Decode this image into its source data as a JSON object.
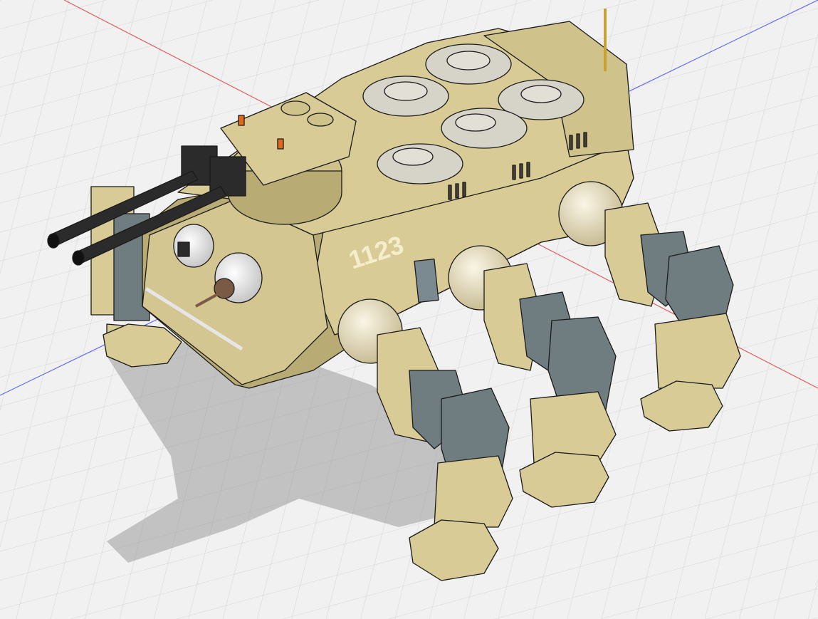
{
  "app": {
    "view": "3D viewport",
    "canvas_background": "#f1f1f1"
  },
  "model": {
    "hull_number": "1123",
    "colors": {
      "body": "#d8cb96",
      "body_shadow": "#b9ab74",
      "body_dark": "#9f9160",
      "plates": "#d6d3c9",
      "metal_grey": "#6f7d80",
      "metal_dark": "#4a5558",
      "gun_black": "#2b2b2b",
      "outline": "#1a1a1a",
      "decal": "#f6edcc",
      "antenna": "#c9a033"
    }
  },
  "grid": {
    "x_axis_color": "#e06060",
    "z_axis_color": "#6a6af0",
    "line_color": "#d0d0d0"
  }
}
